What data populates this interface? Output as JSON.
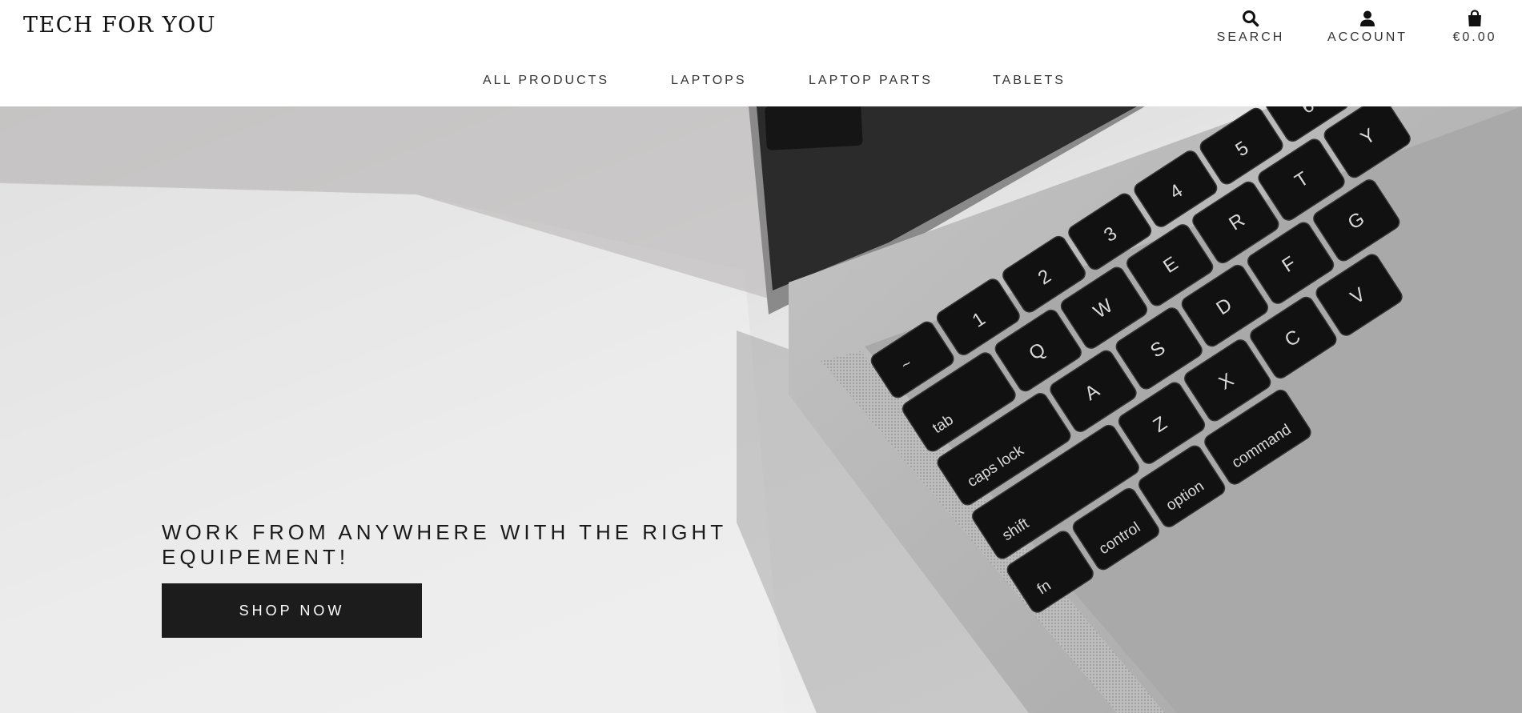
{
  "brand": {
    "name": "TECH FOR YOU"
  },
  "header": {
    "search_label": "SEARCH",
    "account_label": "ACCOUNT",
    "cart_total": "€0.00"
  },
  "nav": {
    "items": [
      {
        "label": "ALL PRODUCTS"
      },
      {
        "label": "LAPTOPS"
      },
      {
        "label": "LAPTOP PARTS"
      },
      {
        "label": "TABLETS"
      }
    ]
  },
  "hero": {
    "tagline": "WORK FROM ANYWHERE WITH THE RIGHT EQUIPEMENT!",
    "cta_label": "SHOP NOW"
  },
  "colors": {
    "accent": "#1c1c1c",
    "text": "#333333",
    "background": "#ffffff"
  },
  "icons": [
    "search-icon",
    "account-icon",
    "shopping-bag-icon"
  ]
}
